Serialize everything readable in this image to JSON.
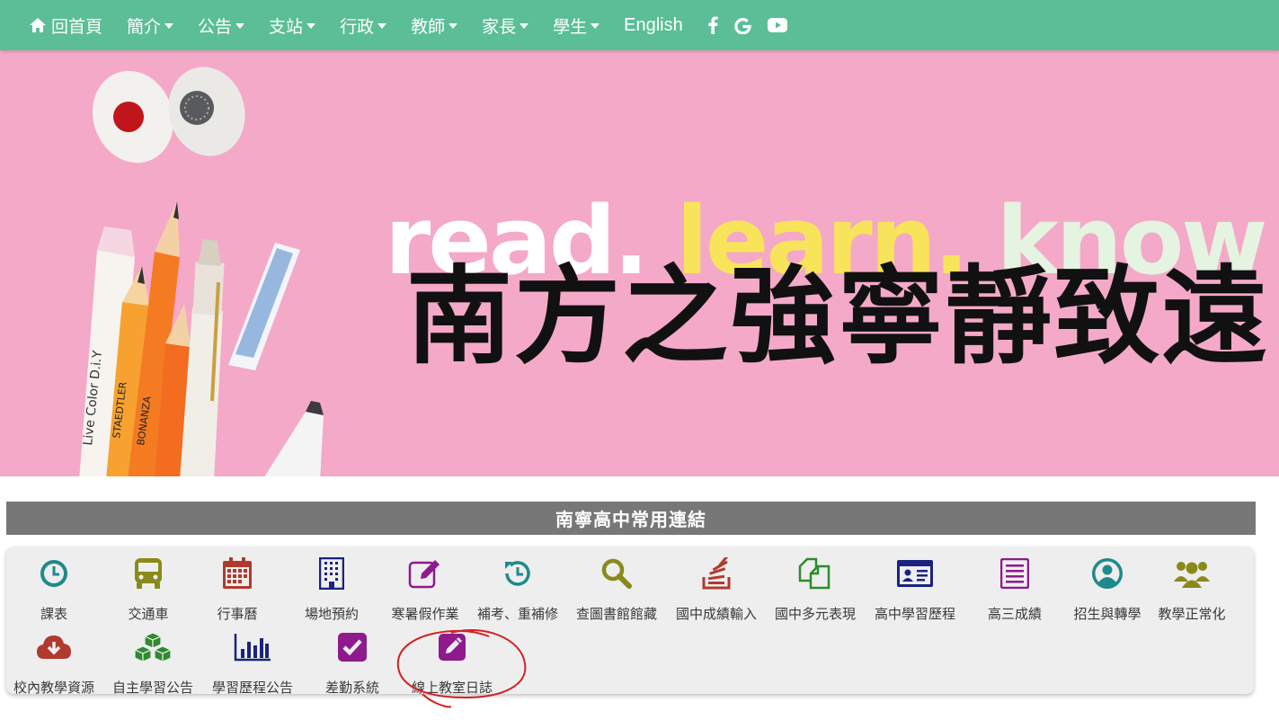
{
  "nav": {
    "home": "回首頁",
    "items": [
      "簡介",
      "公告",
      "支站",
      "行政",
      "教師",
      "家長",
      "學生"
    ],
    "english": "English",
    "social": [
      "facebook-icon",
      "google-icon",
      "youtube-icon"
    ],
    "color": "#5bbe96"
  },
  "banner": {
    "slogan_en": [
      "read.",
      "learn.",
      "know"
    ],
    "slogan_zh": "南方之強寧靜致遠",
    "pencil_texts": [
      "Live Color D.i.Y",
      "STAEDTLER",
      "BONANZA"
    ],
    "background": "#f4a9c8"
  },
  "links_section": {
    "title": "南寧高中常用連結",
    "row1": [
      {
        "label": "課表",
        "icon": "clock-icon",
        "color": "#1f8a8a"
      },
      {
        "label": "交通車",
        "icon": "bus-icon",
        "color": "#8a8a1a"
      },
      {
        "label": "行事曆",
        "icon": "calendar-icon",
        "color": "#b03a2e"
      },
      {
        "label": "場地預約",
        "icon": "building-icon",
        "color": "#1a237e"
      },
      {
        "label": "寒暑假作業",
        "icon": "edit-icon",
        "color": "#8e1a8e"
      },
      {
        "label": "補考、重補修",
        "icon": "history-icon",
        "color": "#1f8a8a"
      },
      {
        "label": "查圖書館館藏",
        "icon": "search-icon",
        "color": "#8a8a1a"
      },
      {
        "label": "國中成績輸入",
        "icon": "stack-icon",
        "color": "#b03a2e"
      },
      {
        "label": "國中多元表現",
        "icon": "files-icon",
        "color": "#2e8b2e"
      },
      {
        "label": "高中學習歷程",
        "icon": "id-card-icon",
        "color": "#1a237e"
      },
      {
        "label": "高三成績",
        "icon": "list-icon",
        "color": "#8e1a8e"
      },
      {
        "label": "招生與轉學",
        "icon": "user-circle-icon",
        "color": "#1f8a8a"
      },
      {
        "label": "教學正常化",
        "icon": "users-icon",
        "color": "#8a8a1a"
      }
    ],
    "row2": [
      {
        "label": "校內教學資源",
        "icon": "cloud-download-icon",
        "color": "#b03a2e"
      },
      {
        "label": "自主學習公告",
        "icon": "cubes-icon",
        "color": "#2e8b2e"
      },
      {
        "label": "學習歷程公告",
        "icon": "bar-chart-icon",
        "color": "#1a237e"
      },
      {
        "label": "差勤系統",
        "icon": "check-square-icon",
        "color": "#8e1a8e"
      },
      {
        "label": "線上教室日誌",
        "icon": "pencil-square-icon",
        "color": "#8e1a8e"
      }
    ]
  }
}
